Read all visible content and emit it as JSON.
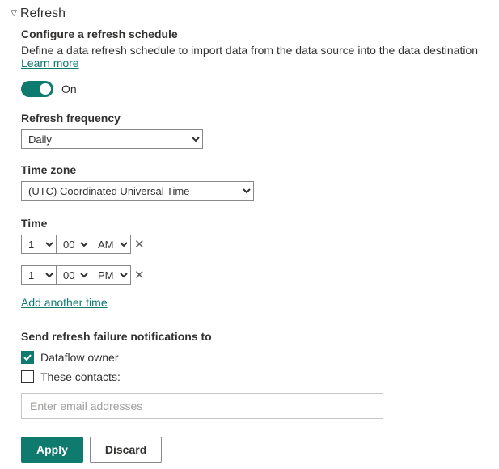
{
  "section": {
    "title": "Refresh",
    "subheading": "Configure a refresh schedule",
    "description": "Define a data refresh schedule to import data from the data source into the data destination ",
    "learn_more": "Learn more"
  },
  "toggle": {
    "on": true,
    "label": "On"
  },
  "fields": {
    "frequency": {
      "label": "Refresh frequency",
      "value": "Daily"
    },
    "timezone": {
      "label": "Time zone",
      "value": "(UTC) Coordinated Universal Time"
    },
    "time": {
      "label": "Time",
      "rows": [
        {
          "hour": "1",
          "minute": "00",
          "ampm": "AM"
        },
        {
          "hour": "1",
          "minute": "00",
          "ampm": "PM"
        }
      ],
      "add_link": "Add another time"
    }
  },
  "notifications": {
    "heading": "Send refresh failure notifications to",
    "dataflow_owner": {
      "checked": true,
      "label": "Dataflow owner"
    },
    "contacts": {
      "checked": false,
      "label": "These contacts:"
    },
    "email_placeholder": "Enter email addresses"
  },
  "buttons": {
    "apply": "Apply",
    "discard": "Discard"
  }
}
